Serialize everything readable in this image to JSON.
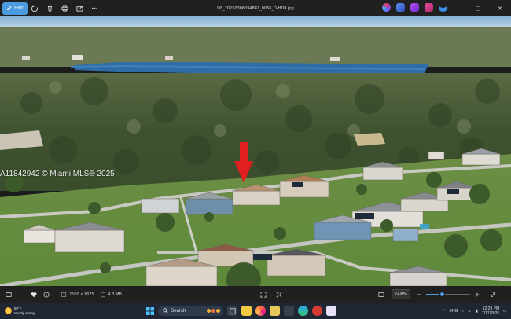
{
  "titlebar": {
    "edit_label": "Edit",
    "filename": "D8_20250306094841_0066_D-HDR.jpg"
  },
  "photo": {
    "watermark": "A11842942 © Miami MLS® 2025",
    "arrow_color": "#e02020"
  },
  "imgbar": {
    "dimensions": "2500 x 1875",
    "filesize": "4.3 MB",
    "zoom": "248%",
    "zoom_slider_level": 0.37
  },
  "taskbar": {
    "weather_temp": "89°F",
    "weather_desc": "Mostly sunny",
    "search_placeholder": "Search",
    "language": "ENG",
    "time": "12:29 PM",
    "date": "7/17/2025"
  },
  "colors": {
    "accent": "#4a9be0",
    "sky": "#9fc3dc",
    "lake": "#2d6fa8"
  }
}
